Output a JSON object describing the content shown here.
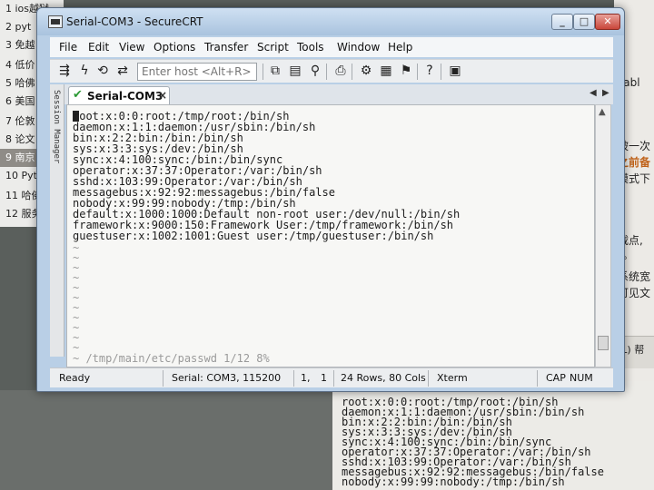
{
  "background": {
    "left_list": [
      "1 ios越狱",
      "2 pyt",
      "3 免越",
      "4 低价",
      "5 哈佛",
      "6 美国",
      "7 伦敦",
      "8 论文",
      "9 南京",
      "10 Pyt",
      "11 哈佛",
      "12 服务"
    ],
    "right_fragments": [
      "sabl",
      "被一次",
      "之前备",
      "模式下",
      "载点,",
      "\"。",
      "系统宽",
      "可见文",
      "(L)  帮"
    ],
    "terminal_lines": [
      "root:x:0:0:root:/tmp/root:/bin/sh",
      "daemon:x:1:1:daemon:/usr/sbin:/bin/sh",
      "bin:x:2:2:bin:/bin:/bin/sh",
      "sys:x:3:3:sys:/dev:/bin/sh",
      "sync:x:4:100:sync:/bin:/bin/sync",
      "operator:x:37:37:Operator:/var:/bin/sh",
      "sshd:x:103:99:Operator:/var:/bin/sh",
      "messagebus:x:92:92:messagebus:/bin/false",
      "nobody:x:99:99:nobody:/tmp:/bin/sh"
    ]
  },
  "window": {
    "title": "Serial-COM3 - SecureCRT",
    "controls": {
      "minimize": "_",
      "maximize": "□",
      "close": "✕"
    }
  },
  "menubar": [
    "File",
    "Edit",
    "View",
    "Options",
    "Transfer",
    "Script",
    "Tools",
    "Window",
    "Help"
  ],
  "toolbar": {
    "host_placeholder": "Enter host <Alt+R>",
    "icons": [
      "connect-icon",
      "quick-connect-icon",
      "reconnect-icon",
      "disconnect-icon",
      "copy-icon",
      "paste-icon",
      "find-icon",
      "print-icon",
      "settings-icon",
      "session-options-icon",
      "keymap-icon",
      "help-icon",
      "sftp-icon"
    ]
  },
  "session_manager": {
    "label": "Session Manager"
  },
  "tab": {
    "label": "Serial-COM3",
    "close": "×"
  },
  "terminal": {
    "lines": [
      "root:x:0:0:root:/tmp/root:/bin/sh",
      "daemon:x:1:1:daemon:/usr/sbin:/bin/sh",
      "bin:x:2:2:bin:/bin:/bin/sh",
      "sys:x:3:3:sys:/dev:/bin/sh",
      "sync:x:4:100:sync:/bin:/bin/sync",
      "operator:x:37:37:Operator:/var:/bin/sh",
      "sshd:x:103:99:Operator:/var:/bin/sh",
      "messagebus:x:92:92:messagebus:/bin/false",
      "nobody:x:99:99:nobody:/tmp:/bin/sh",
      "default:x:1000:1000:Default non-root user:/dev/null:/bin/sh",
      "framework:x:9000:150:Framework User:/tmp/framework:/bin/sh",
      "guestuser:x:1002:1001:Guest user:/tmp/guestuser:/bin/sh"
    ],
    "tilde": "~",
    "tilde_count": 11,
    "vim_status": "~ /tmp/main/etc/passwd 1/12 8%"
  },
  "statusbar": {
    "state": "Ready",
    "connection": "Serial: COM3, 115200",
    "row": "1,",
    "col": "1",
    "size": "24 Rows, 80 Cols",
    "emulation": "Xterm",
    "cap": "CAP",
    "num": "NUM"
  },
  "colors": {
    "title_gradient_top": "#cfe0f2",
    "close_button": "#c9463a",
    "tab_check": "#2d9a36"
  }
}
